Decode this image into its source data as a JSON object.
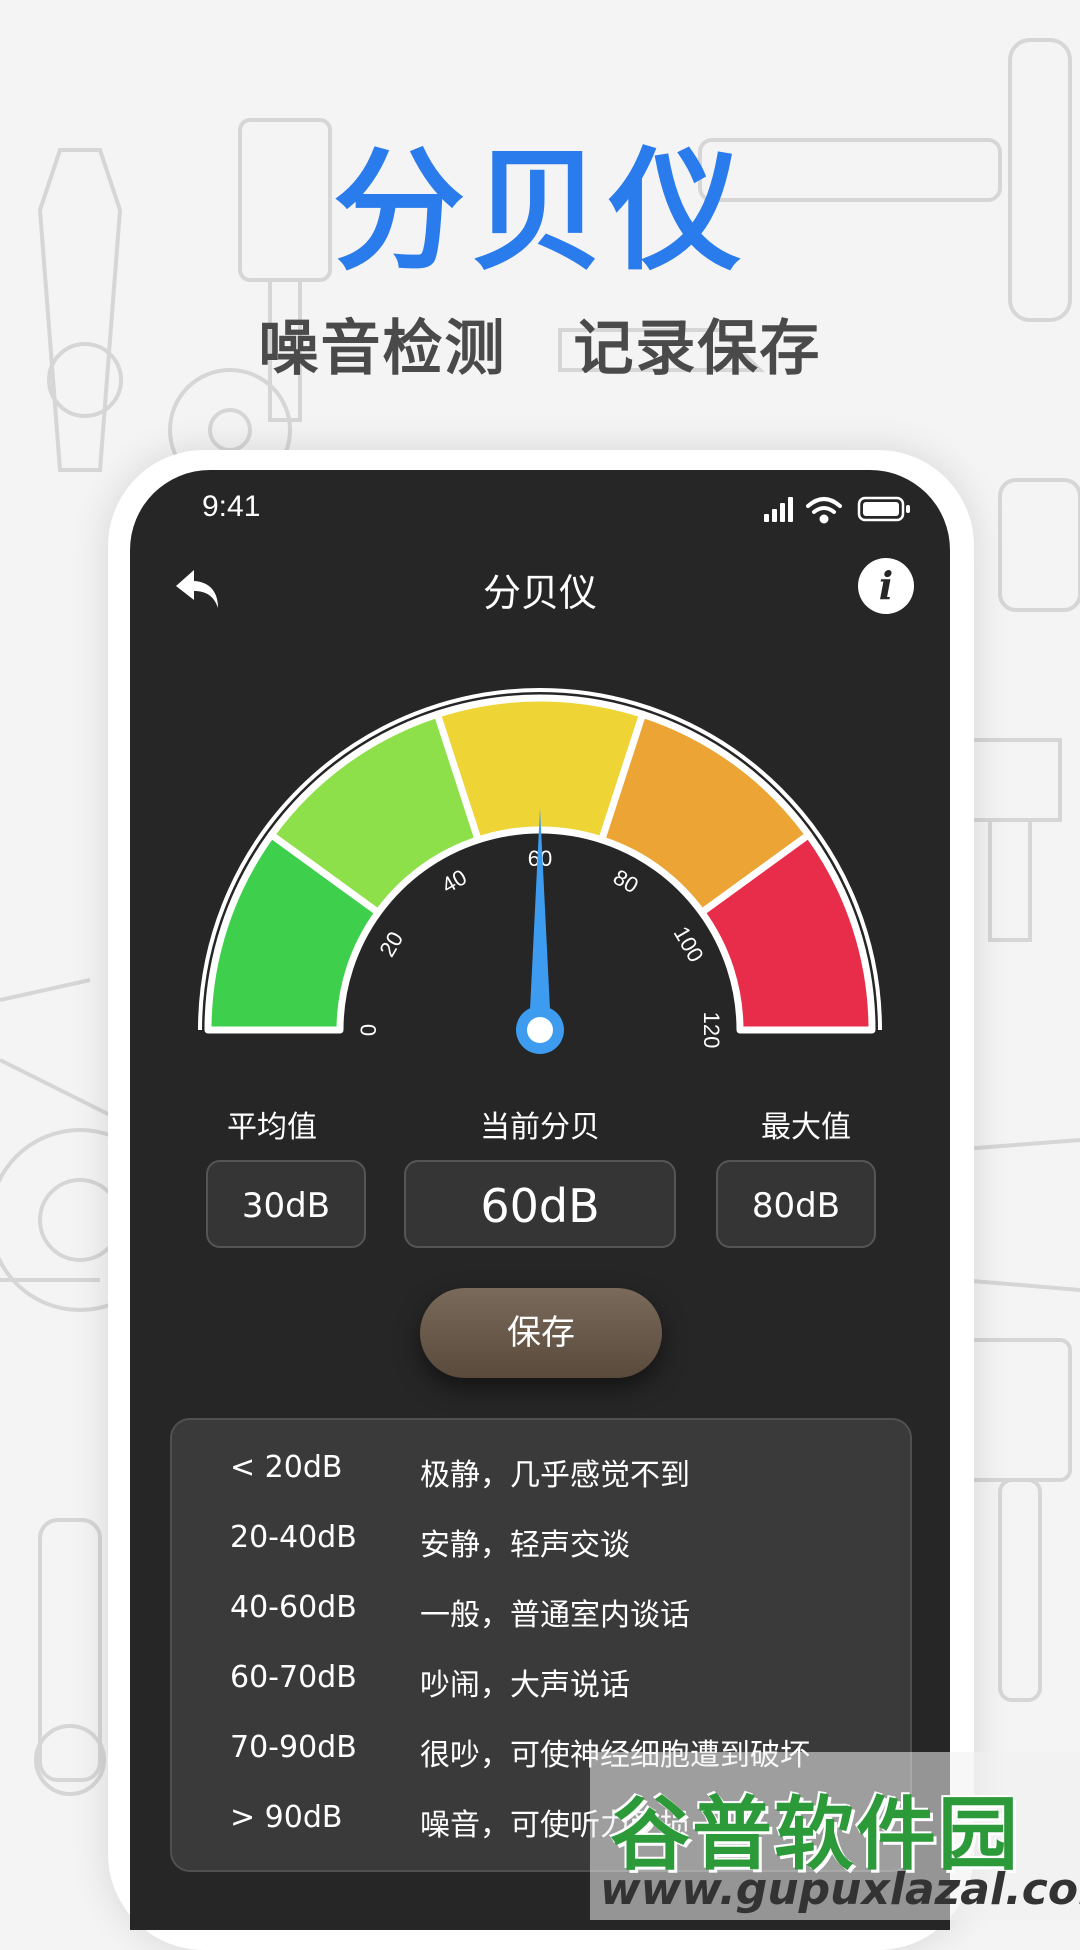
{
  "hero": {
    "title": "分贝仪",
    "subtitle_1": "噪音检测",
    "subtitle_2": "记录保存"
  },
  "status_bar": {
    "time": "9:41",
    "icons": [
      "signal-icon",
      "wifi-icon",
      "battery-icon"
    ]
  },
  "nav": {
    "title": "分贝仪",
    "back_icon": "back-arrow-icon",
    "info_icon": "info-icon",
    "info_glyph": "i"
  },
  "gauge": {
    "min": 0,
    "max": 120,
    "ticks": [
      "0",
      "20",
      "40",
      "60",
      "80",
      "100",
      "120"
    ],
    "current_value": 60,
    "segments": [
      {
        "from": 0,
        "to": 24,
        "color": "#3ecf4c"
      },
      {
        "from": 24,
        "to": 48,
        "color": "#8ee04a"
      },
      {
        "from": 48,
        "to": 72,
        "color": "#eed535"
      },
      {
        "from": 72,
        "to": 96,
        "color": "#eca535"
      },
      {
        "from": 96,
        "to": 120,
        "color": "#e82d4a"
      }
    ],
    "needle_color": "#3d9cf0"
  },
  "stats": {
    "average_label": "平均值",
    "average_value": "30dB",
    "current_label": "当前分贝",
    "current_value": "60dB",
    "max_label": "最大值",
    "max_value": "80dB"
  },
  "save_label": "保存",
  "reference": [
    {
      "range": "< 20dB",
      "desc": "极静，几乎感觉不到"
    },
    {
      "range": "20-40dB",
      "desc": "安静，轻声交谈"
    },
    {
      "range": "40-60dB",
      "desc": "一般，普通室内谈话"
    },
    {
      "range": "60-70dB",
      "desc": "吵闹，大声说话"
    },
    {
      "range": "70-90dB",
      "desc": "很吵，可使神经细胞遭到破坏"
    },
    {
      "range": "> 90dB",
      "desc": "噪音，可使听力受损"
    }
  ],
  "watermark": {
    "title": "谷普软件园",
    "url": "www.gupuxlazal.com"
  },
  "colors": {
    "accent_blue": "#2a7bec",
    "phone_bg": "#262626",
    "watermark_green": "#2d9a3a"
  }
}
